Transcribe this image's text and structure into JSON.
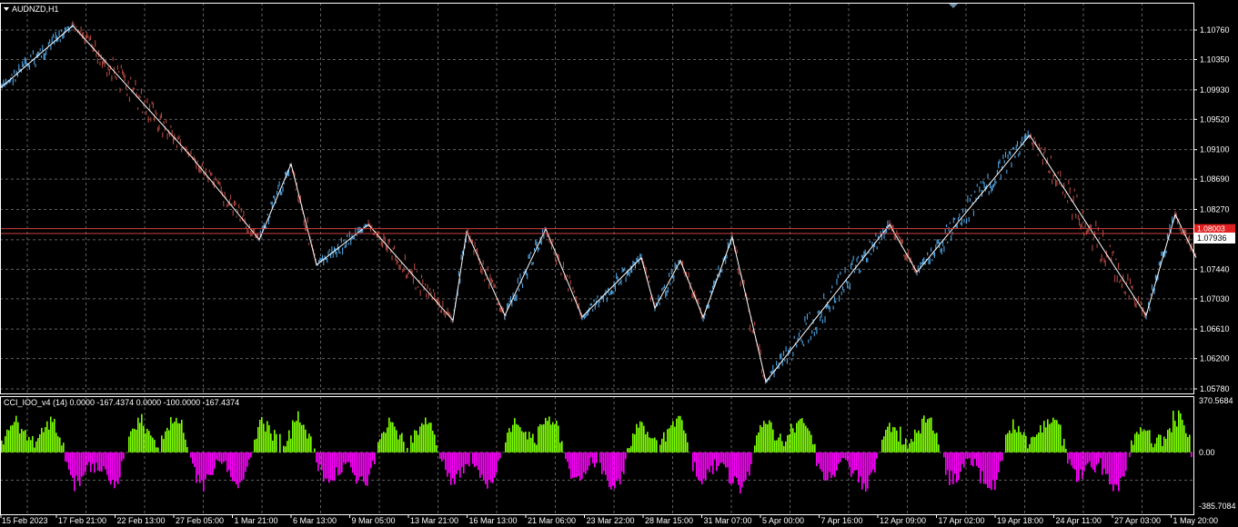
{
  "symbol_title": "AUDNZD,H1",
  "indicator_title": "CCI_IOO_v4 (14) 0.0000 -167.4374 0.0000 -100.0000 -167.4374",
  "colors": {
    "background": "#000000",
    "grid": "#5f5f5f",
    "axis": "#ffffff",
    "bull": "#4fa3e0",
    "bear": "#b04840",
    "zigzag": "#ffffff",
    "hline": "#d04040",
    "cci_pos": "#7fff00",
    "cci_neg": "#ff00ff"
  },
  "price_axis": {
    "ticks": [
      "1.10760",
      "1.10350",
      "1.09930",
      "1.09520",
      "1.09100",
      "1.08690",
      "1.08270",
      "1.07850",
      "1.07440",
      "1.07030",
      "1.06610",
      "1.06200",
      "1.05780"
    ],
    "current_price": "1.07936",
    "current_price_hidden": "1.08003"
  },
  "cci_axis": {
    "ticks": [
      "370.5684",
      "0.00",
      "-385.7084"
    ]
  },
  "time_axis": {
    "labels": [
      "15 Feb 2023",
      "17 Feb 21:00",
      "22 Feb 13:00",
      "27 Feb 05:00",
      "1 Mar 21:00",
      "6 Mar 13:00",
      "9 Mar 05:00",
      "13 Mar 21:00",
      "16 Mar 13:00",
      "21 Mar 06:00",
      "23 Mar 22:00",
      "28 Mar 15:00",
      "31 Mar 07:00",
      "5 Apr 00:00",
      "7 Apr 16:00",
      "12 Apr 09:00",
      "17 Apr 02:00",
      "19 Apr 18:00",
      "24 Apr 11:00",
      "27 Apr 03:00",
      "1 May 20:00"
    ]
  },
  "chart_data": [
    {
      "type": "line",
      "title": "AUDNZD,H1",
      "ylim": [
        1.0578,
        1.1076
      ],
      "series": [
        {
          "name": "ZigZag",
          "x_index": [
            0,
            80,
            212,
            285,
            320,
            348,
            405,
            498,
            513,
            555,
            600,
            640,
            705,
            720,
            748,
            773,
            805,
            842,
            978,
            1008,
            1132,
            1260,
            1292,
            1315
          ],
          "y": [
            1.0995,
            1.1082,
            1.0898,
            1.0785,
            1.089,
            1.075,
            1.0806,
            1.0673,
            1.0796,
            1.068,
            1.08,
            1.0678,
            1.076,
            1.069,
            1.0756,
            1.0677,
            1.0788,
            1.0588,
            1.0806,
            1.074,
            1.093,
            1.068,
            1.082,
            1.076
          ]
        }
      ]
    },
    {
      "type": "bar",
      "title": "CCI_IOO_v4 (14)",
      "ylim": [
        -385.7084,
        370.5684
      ],
      "series": [
        {
          "name": "CCI",
          "current": -167.4374
        }
      ]
    }
  ]
}
